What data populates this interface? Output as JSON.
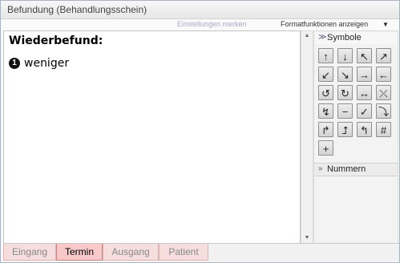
{
  "window": {
    "title": "Befundung (Behandlungsschein)"
  },
  "toolbar": {
    "settings_link": "Einstellungen merken",
    "format_label": "Formatfunktionen anzeigen",
    "dropdown_icon": "dropdown-arrow-icon"
  },
  "editor": {
    "heading": "Wiederbefund:",
    "items": [
      {
        "marker": "1",
        "text": "weniger"
      }
    ]
  },
  "panel": {
    "symbols_header": "Symbole",
    "numbers_header": "Nummern",
    "symbols": [
      {
        "glyph": "↑",
        "name": "arrow-up-icon"
      },
      {
        "glyph": "↓",
        "name": "arrow-down-icon"
      },
      {
        "glyph": "↖",
        "name": "arrow-up-left-icon"
      },
      {
        "glyph": "↗",
        "name": "arrow-up-right-icon"
      },
      {
        "glyph": "↙",
        "name": "arrow-down-left-icon"
      },
      {
        "glyph": "↘",
        "name": "arrow-down-right-icon"
      },
      {
        "glyph": "→",
        "name": "arrow-right-icon"
      },
      {
        "glyph": "←",
        "name": "arrow-left-icon"
      },
      {
        "glyph": "↺",
        "name": "rotate-ccw-icon"
      },
      {
        "glyph": "↻",
        "name": "rotate-cw-icon"
      },
      {
        "glyph": "↔",
        "name": "arrow-left-right-icon"
      },
      {
        "glyph": "⤫",
        "name": "cross-arrows-icon"
      },
      {
        "glyph": "↯",
        "name": "zigzag-arrow-icon"
      },
      {
        "glyph": "−",
        "name": "minus-icon"
      },
      {
        "glyph": "✓",
        "name": "check-icon"
      },
      {
        "glyph": "⤵",
        "name": "turn-down-icon"
      },
      {
        "glyph": "↱",
        "name": "turn-up-left-icon"
      },
      {
        "glyph": "⮥",
        "name": "turn-up-icon"
      },
      {
        "glyph": "↰",
        "name": "turn-left-icon"
      },
      {
        "glyph": "#",
        "name": "hash-icon"
      },
      {
        "glyph": "+",
        "name": "plus-icon"
      }
    ]
  },
  "tabs": [
    {
      "label": "Eingang",
      "active": false
    },
    {
      "label": "Termin",
      "active": true
    },
    {
      "label": "Ausgang",
      "active": false
    },
    {
      "label": "Patient",
      "active": false
    }
  ],
  "colors": {
    "active_tab": "#f9c9c9",
    "inactive_tab": "#f7dede",
    "window_border": "#a9b3c0"
  }
}
